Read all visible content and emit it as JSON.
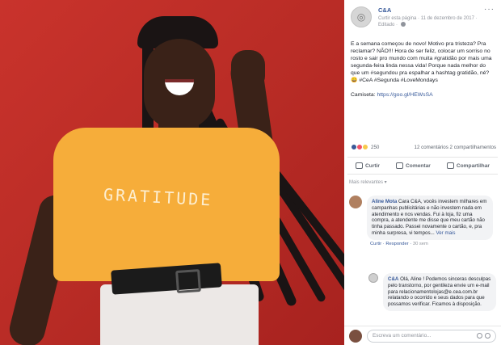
{
  "post": {
    "page_name": "C&A",
    "meta": "Curtir esta página · 11 de dezembro de 2017 ·",
    "meta2": "Editado ·",
    "more": "···",
    "body_para1": "E a semana começou de novo! Motivo pra tristeza? Pra reclamar? NÃO!!! Hora de ser feliz, colocar um sorriso no rosto e sair pro mundo com muita #gratidão por mais uma segunda-feira linda nessa vida! Porque nada melhor do que um #segundou pra espalhar a hashtag gratidão, né? 😄 #CeA #Segunda #LoveMondays",
    "body_para2_label": "Camiseta:",
    "body_para2_link": "https://goo.gl/HEWsSA"
  },
  "reactions": {
    "count": "250",
    "summary": "12 comentários  2 compartilhamentos"
  },
  "actions": {
    "like": "Curtir",
    "comment": "Comentar",
    "share": "Compartilhar"
  },
  "sort_label": "Mais relevantes ▾",
  "comment1": {
    "author": "Aline Mota",
    "text": "Cara C&A, vocês investem milhares em campanhas publicitárias e não investem nada em atendimento e nos vendas. Fui à loja, fiz uma compra, a atendente me disse que meu cartão não tinha passado. Passei novamente o cartão, e, pra minha surpresa, vi tempos...",
    "see_more": "Ver mais",
    "like": "Curtir",
    "reply": "Responder",
    "time": "30 sem"
  },
  "comment2": {
    "author": "C&A",
    "text": "Olá, Aline ! Podemos sinceras desculpas pelo transtorno, por gentileza envie um e-mail para relacionamentolojas@e.cea.com.br relatando o ocorrido e seus dados para que possamos verificar. Ficamos à disposição."
  },
  "write": {
    "placeholder": "Escreva um comentário..."
  },
  "shirt_text": "GRATITUDE",
  "colors": {
    "link": "#365899",
    "background_photo": "#c9332c",
    "shirt": "#f6ad3a"
  }
}
